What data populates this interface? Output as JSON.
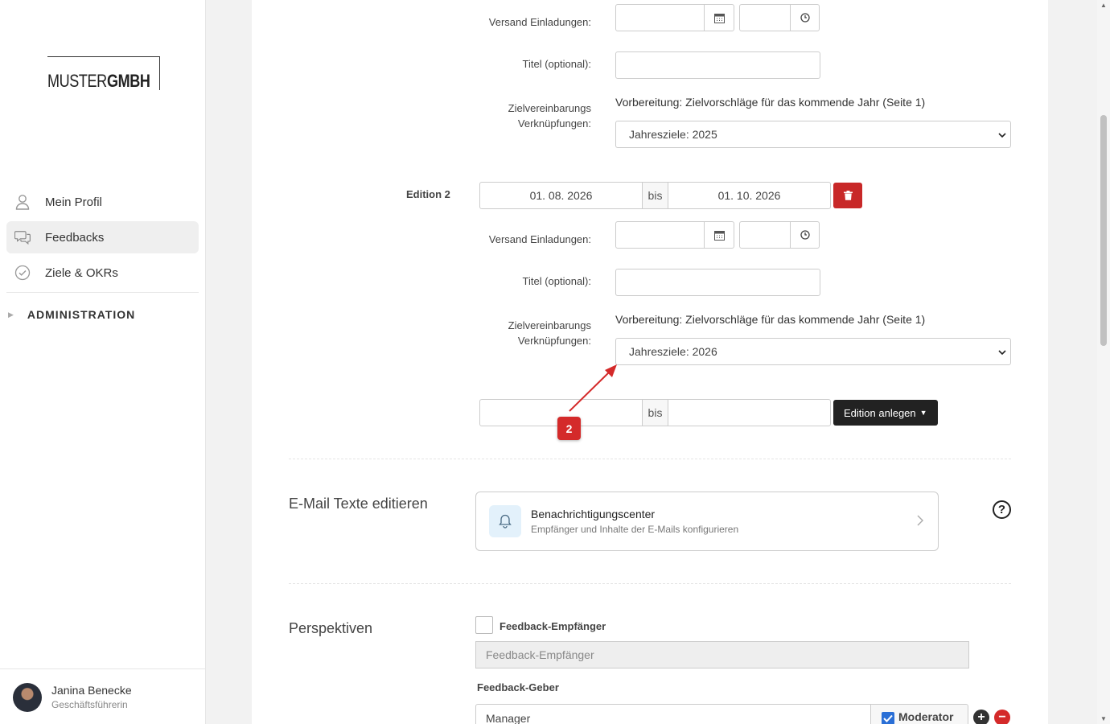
{
  "sidebar": {
    "logo": {
      "part1": "MUSTER",
      "part2": "GMBH"
    },
    "items": [
      {
        "label": "Mein Profil",
        "icon": "user-icon"
      },
      {
        "label": "Feedbacks",
        "icon": "chat-icon",
        "active": true
      },
      {
        "label": "Ziele & OKRs",
        "icon": "check-circle-icon"
      }
    ],
    "admin_label": "ADMINISTRATION",
    "user": {
      "name": "Janina Benecke",
      "role": "Geschäftsführerin"
    }
  },
  "edition1": {
    "versand_label": "Versand Einladungen:",
    "titel_label": "Titel (optional):",
    "ziel_label_1": "Zielvereinbarungs",
    "ziel_label_2": "Verknüpfungen:",
    "ziel_text": "Vorbereitung: Zielvorschläge für das kommende Jahr (Seite 1)",
    "select_value": "Jahresziele: 2025"
  },
  "edition2": {
    "label": "Edition 2",
    "date_from": "01. 08. 2026",
    "bis": "bis",
    "date_to": "01. 10. 2026",
    "versand_label": "Versand Einladungen:",
    "titel_label": "Titel (optional):",
    "ziel_label_1": "Zielvereinbarungs",
    "ziel_label_2": "Verknüpfungen:",
    "ziel_text": "Vorbereitung: Zielvorschläge für das kommende Jahr (Seite 1)",
    "select_value": "Jahresziele: 2026"
  },
  "new_edition": {
    "bis": "bis",
    "button_label": "Edition anlegen"
  },
  "annotation": {
    "number": "2",
    "color": "#d42a2a"
  },
  "email_section": {
    "title": "E-Mail Texte editieren",
    "card_title": "Benachrichtigungscenter",
    "card_subtitle": "Empfänger und Inhalte der E-Mails konfigurieren",
    "help": "?"
  },
  "perspektiven": {
    "title": "Perspektiven",
    "empfaenger_label": "Feedback-Empfänger",
    "empfaenger_placeholder": "Feedback-Empfänger",
    "geber_label": "Feedback-Geber",
    "geber_value": "Manager",
    "moderator_label": "Moderator"
  },
  "colors": {
    "accent_red": "#c82828",
    "checkbox_blue": "#2a6fd6",
    "dark_button": "#222222"
  }
}
